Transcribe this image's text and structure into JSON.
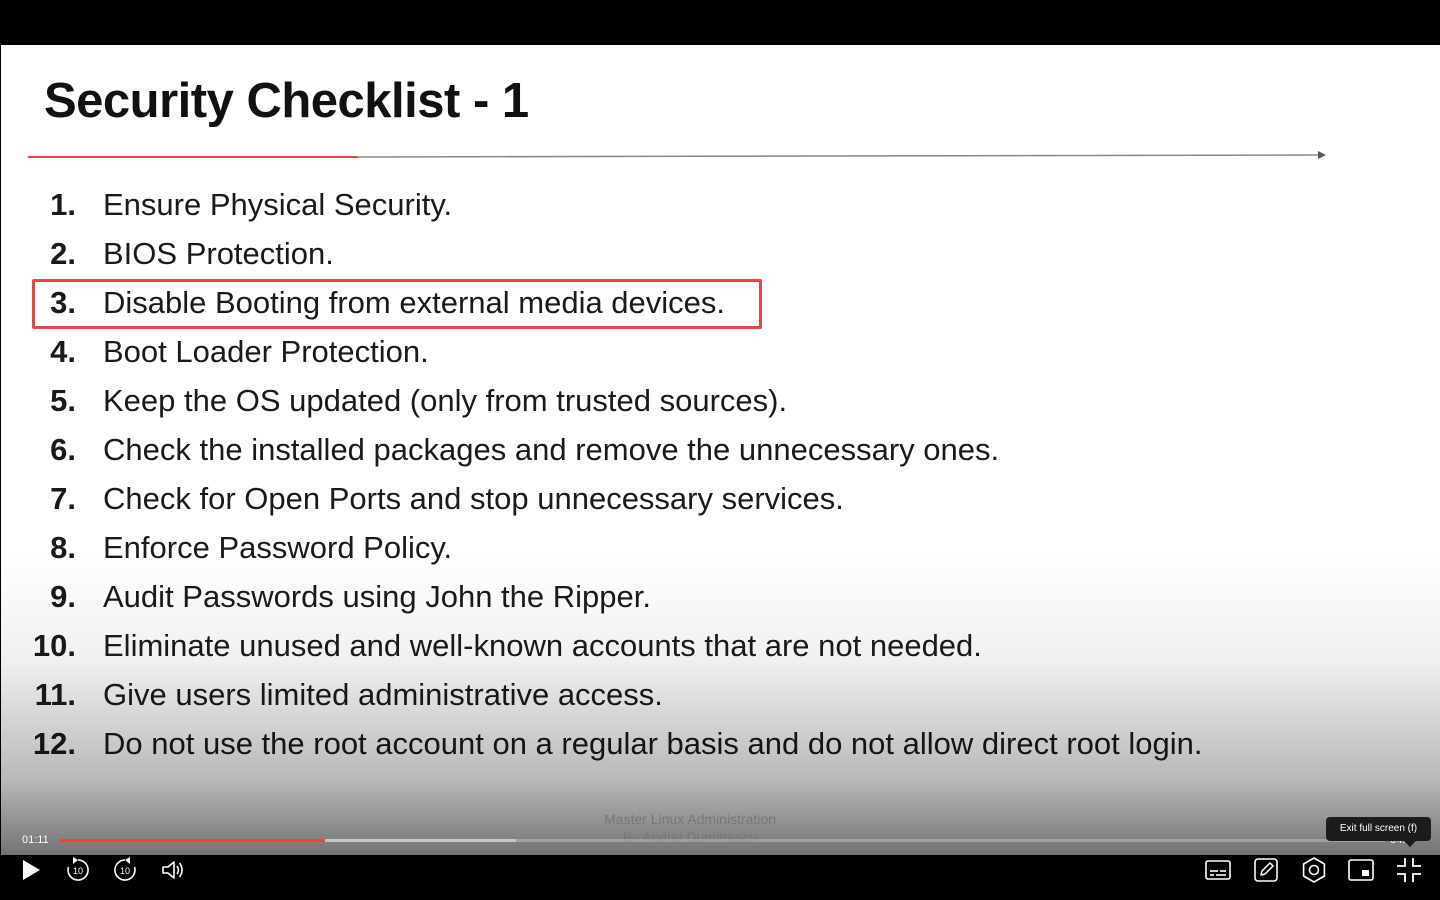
{
  "slide": {
    "title": "Security Checklist - 1",
    "items": [
      {
        "num": "1.",
        "text": "Ensure Physical Security."
      },
      {
        "num": "2.",
        "text": "BIOS Protection."
      },
      {
        "num": "3.",
        "text": "Disable Booting from external media devices."
      },
      {
        "num": "4.",
        "text": "Boot Loader Protection."
      },
      {
        "num": "5.",
        "text": "Keep the OS updated (only from trusted sources)."
      },
      {
        "num": "6.",
        "text": "Check the installed packages and remove the unnecessary ones."
      },
      {
        "num": "7.",
        "text": "Check for Open Ports and stop unnecessary services."
      },
      {
        "num": "8.",
        "text": "Enforce Password Policy."
      },
      {
        "num": "9.",
        "text": "Audit Passwords using John the Ripper."
      },
      {
        "num": "10.",
        "text": "Eliminate unused and well-known accounts that are not needed."
      },
      {
        "num": "11.",
        "text": "Give users limited administrative access."
      },
      {
        "num": "12.",
        "text": "Do not use the root account on a regular basis and do not allow direct root login."
      }
    ],
    "highlighted_item": 3,
    "watermark_line1": "Master Linux Administration",
    "watermark_line2": "By Andrei Dumitrescu",
    "highlight_color": "#e84545"
  },
  "player": {
    "time_current": "01:11",
    "time_total": "04:??",
    "progress_fraction": 0.2,
    "buffer_fraction": 0.344,
    "progress_color": "#e8453c",
    "tooltip": "Exit full screen (f)",
    "controls": [
      {
        "name": "play-icon"
      },
      {
        "name": "rewind-10-icon",
        "label": "10"
      },
      {
        "name": "forward-10-icon",
        "label": "10"
      },
      {
        "name": "volume-icon"
      },
      {
        "name": "captions-icon"
      },
      {
        "name": "notes-icon"
      },
      {
        "name": "settings-icon"
      },
      {
        "name": "picture-in-picture-icon"
      },
      {
        "name": "exit-fullscreen-icon"
      }
    ]
  }
}
